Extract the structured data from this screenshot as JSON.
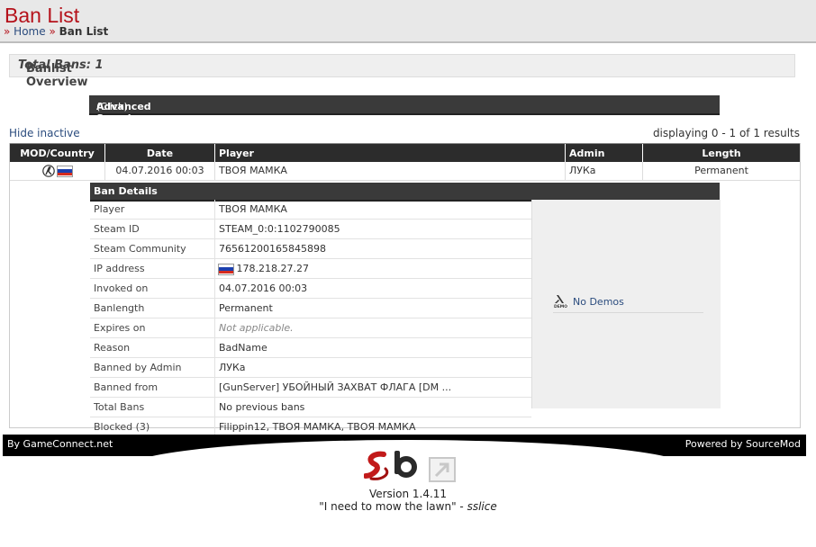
{
  "header": {
    "title": "Ban List",
    "breadcrumb": {
      "sep": "»",
      "home": "Home",
      "current": "Ban List"
    }
  },
  "overview": {
    "title": "Banlist Overview",
    "dash": " - ",
    "total_label": "Total Bans: 1"
  },
  "advanced_search": {
    "label": "Advanced Search",
    "hint": "(Click)"
  },
  "list_controls": {
    "hide_inactive": "Hide inactive",
    "displaying": "displaying 0 - 1 of 1 results"
  },
  "table": {
    "headers": [
      "MOD/Country",
      "Date",
      "Player",
      "Admin",
      "Length"
    ],
    "row": {
      "date": "04.07.2016 00:03",
      "player": "ТВОЯ МАМКА",
      "admin": "ЛУКа",
      "length": "Permanent",
      "country_flag": "russia-flag"
    }
  },
  "details": {
    "title": "Ban Details",
    "rows": [
      {
        "label": "Player",
        "value": "ТВОЯ МАМКА"
      },
      {
        "label": "Steam ID",
        "value": "STEAM_0:0:1102790085"
      },
      {
        "label": "Steam Community",
        "value": "76561200165845898"
      },
      {
        "label": "IP address",
        "value": "178.218.27.27"
      },
      {
        "label": "Invoked on",
        "value": "04.07.2016 00:03"
      },
      {
        "label": "Banlength",
        "value": "Permanent"
      },
      {
        "label": "Expires on",
        "value": "Not applicable."
      },
      {
        "label": "Reason",
        "value": "BadName"
      },
      {
        "label": "Banned by Admin",
        "value": "ЛУКа"
      },
      {
        "label": "Banned from",
        "value": "[GunServer] УБОЙНЫЙ ЗАХВАТ ФЛАГА [DM ..."
      },
      {
        "label": "Total Bans",
        "value": "No previous bans"
      },
      {
        "label": "Blocked (3)",
        "value": "Filippin12, ТВОЯ МАМКА, ТВОЯ МАМКА"
      }
    ],
    "demos": "No Demos"
  },
  "footer": {
    "left": "By GameConnect.net",
    "right": "Powered by SourceMod",
    "version": "Version 1.4.11",
    "quote": "\"I need to mow the lawn\"",
    "quote_sep": " - ",
    "quote_author": "sslice"
  },
  "colors": {
    "accent": "#b5121b",
    "link": "#2b4c7e",
    "header_bg": "#2c2c2c"
  }
}
